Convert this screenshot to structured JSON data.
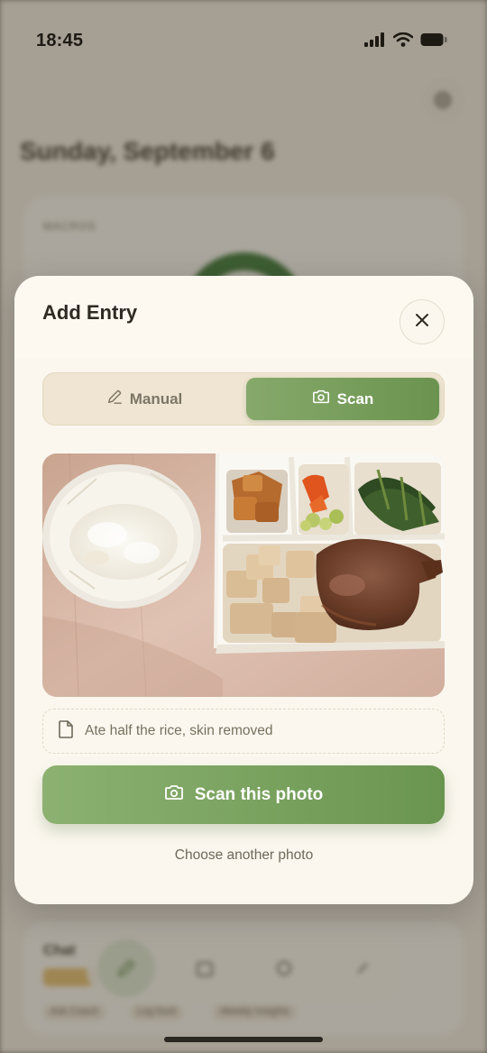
{
  "status_bar": {
    "time": "18:45"
  },
  "background": {
    "date_title": "Sunday, September 6",
    "card_label": "MACROS",
    "bottom_card_label": "Chat",
    "chips": [
      "Ask Coach",
      "Log food",
      "Weekly Insights"
    ]
  },
  "modal": {
    "title": "Add Entry",
    "tabs": {
      "manual_label": "Manual",
      "scan_label": "Scan",
      "active": "Scan"
    },
    "photo_alt": "Lunch box with rice, braised tofu, stewed chicken leg, vegetables",
    "note_value": "Ate half the rice, skin removed",
    "scan_button_label": "Scan this photo",
    "choose_another_label": "Choose another photo"
  },
  "colors": {
    "accent_green": "#6b934f",
    "modal_bg": "#fbf7ef",
    "segment_bg": "#efe5d2"
  },
  "icons": [
    "signal-icon",
    "wifi-icon",
    "battery-icon",
    "close-icon",
    "pencil-icon",
    "camera-icon",
    "document-icon"
  ]
}
